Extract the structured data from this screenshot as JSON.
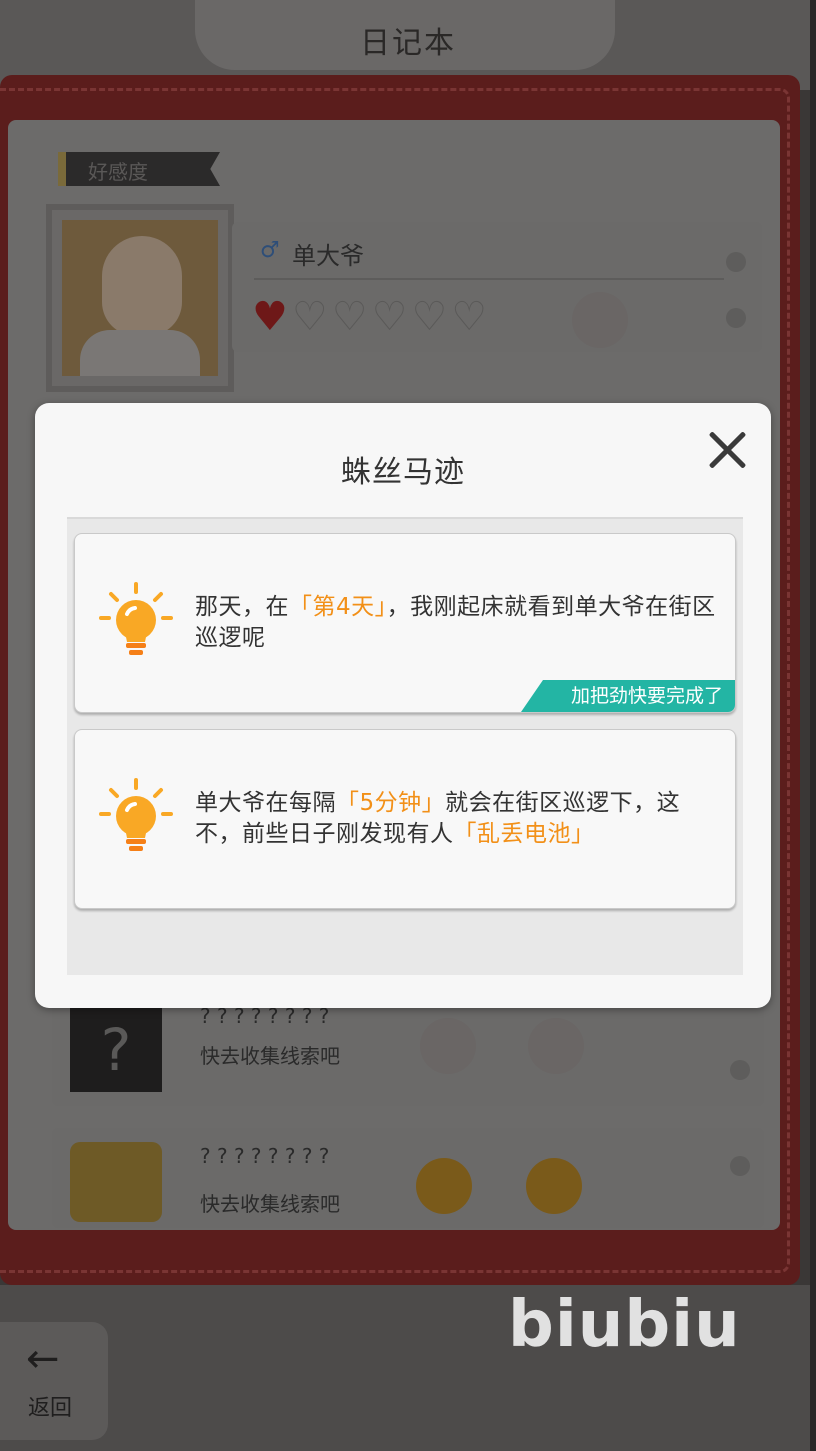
{
  "app": {
    "notebook_title": "日记本",
    "section_label": "好感度"
  },
  "character": {
    "name": "单大爷",
    "hearts_filled": 1,
    "hearts_total": 6,
    "heart_full": "♥",
    "hearts_empty": "♡♡♡♡♡"
  },
  "background_rows": [
    {
      "name": "? ? ? ? ? ? ? ?",
      "hint": "快去收集线索吧"
    },
    {
      "name": "? ? ? ? ? ? ? ?",
      "hint": "快去收集线索吧"
    }
  ],
  "modal": {
    "title": "蛛丝马迹",
    "close_icon": "close-icon",
    "clues": [
      {
        "parts": [
          "那天，在",
          "「第4天」",
          "，我刚起床就看到单大爷在街区巡逻呢"
        ],
        "badge": "加把劲快要完成了"
      },
      {
        "parts": [
          "单大爷在每隔",
          "「5分钟」",
          "就会在街区巡逻下，这不，前些日子刚发现有人",
          "「乱丢电池」"
        ]
      }
    ]
  },
  "bottom": {
    "back_label": "返回",
    "back_arrow": "←"
  },
  "watermark": "biubiu",
  "colors": {
    "highlight": "#f29018",
    "badge": "#23b5a4",
    "bulb": "#f9a825"
  }
}
